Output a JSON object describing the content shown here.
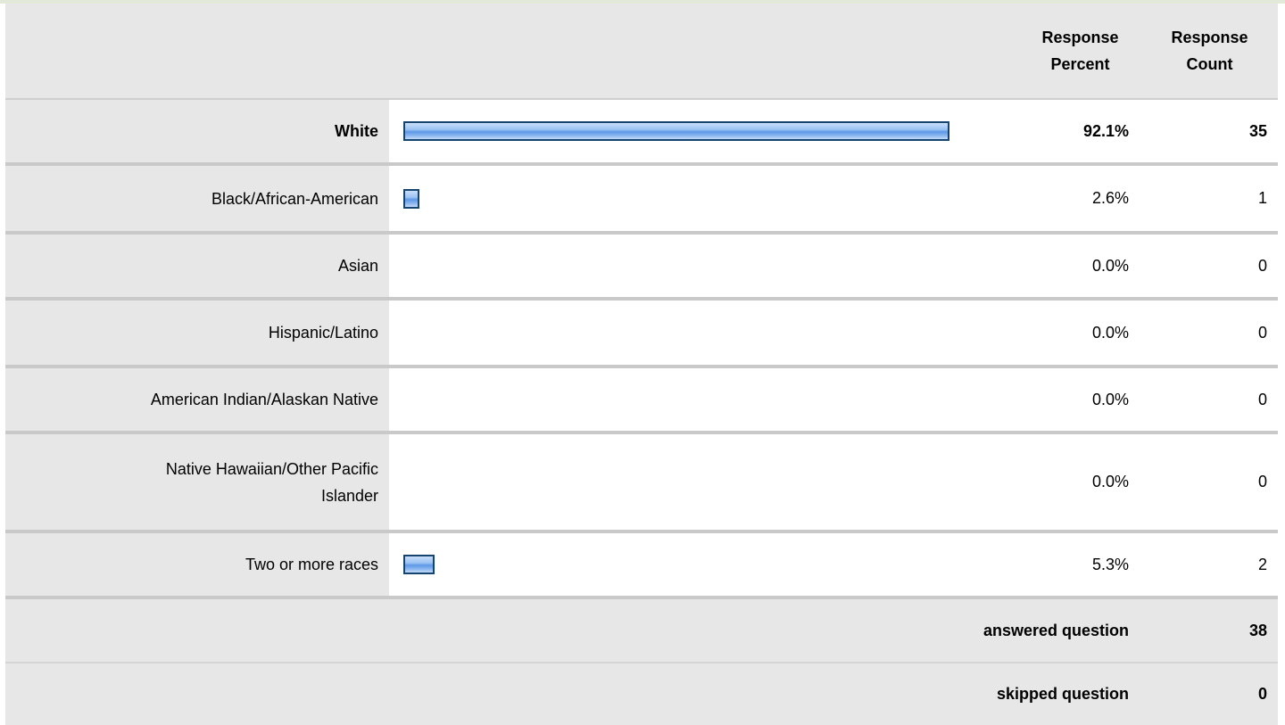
{
  "header": {
    "percent_label_line1": "Response",
    "percent_label_line2": "Percent",
    "count_label_line1": "Response",
    "count_label_line2": "Count"
  },
  "rows": [
    {
      "label": "White",
      "percent_text": "92.1%",
      "count": "35",
      "percent": 92.1,
      "bold": true
    },
    {
      "label": "Black/African-American",
      "percent_text": "2.6%",
      "count": "1",
      "percent": 2.6,
      "bold": false
    },
    {
      "label": "Asian",
      "percent_text": "0.0%",
      "count": "0",
      "percent": 0.0,
      "bold": false
    },
    {
      "label": "Hispanic/Latino",
      "percent_text": "0.0%",
      "count": "0",
      "percent": 0.0,
      "bold": false
    },
    {
      "label": "American Indian/Alaskan Native",
      "percent_text": "0.0%",
      "count": "0",
      "percent": 0.0,
      "bold": false
    },
    {
      "label_line1": "Native Hawaiian/Other Pacific",
      "label_line2": "Islander",
      "percent_text": "0.0%",
      "count": "0",
      "percent": 0.0,
      "bold": false
    },
    {
      "label": "Two or more races",
      "percent_text": "5.3%",
      "count": "2",
      "percent": 5.3,
      "bold": false
    }
  ],
  "summary": {
    "answered_label": "answered question",
    "answered_count": "38",
    "skipped_label": "skipped question",
    "skipped_count": "0"
  },
  "colors": {
    "header_bg": "#e7e7e7",
    "bar_border": "#15446f",
    "bar_fill": "#5d97e6"
  }
}
